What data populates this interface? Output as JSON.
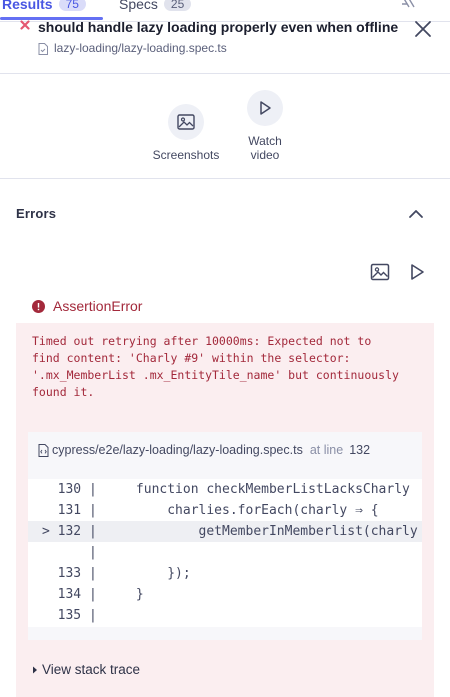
{
  "tabs": [
    {
      "label": "Results",
      "count": "75"
    },
    {
      "label": "Specs",
      "count": "25"
    }
  ],
  "test": {
    "title": "should handle lazy loading properly even when offline",
    "spec_path": "lazy-loading/lazy-loading.spec.ts"
  },
  "artifacts": {
    "screenshots_label": "Screenshots",
    "video_label_line1": "Watch",
    "video_label_line2": "video"
  },
  "errors": {
    "title": "Errors",
    "type": "AssertionError",
    "message": "Timed out retrying after 10000ms: Expected not to\nfind content: 'Charly #9' within the selector:\n'.mx_MemberList .mx_EntityTile_name' but continuously\nfound it.",
    "file_path": "cypress/e2e/lazy-loading/lazy-loading.spec.ts",
    "at_line_text": "at line",
    "line_number": "132",
    "code_lines": [
      "  130 |     function checkMemberListLacksCharly",
      "  131 |         charlies.forEach(charly ⇒ {",
      "> 132 |             getMemberInMemberlist(charly",
      "      |",
      "  133 |         });",
      "  134 |     }",
      "  135 |"
    ],
    "stack_trace_label": "View stack trace"
  },
  "colors": {
    "accent": "#4956e3",
    "error": "#a3293b",
    "error_bg": "#fbeef0"
  }
}
